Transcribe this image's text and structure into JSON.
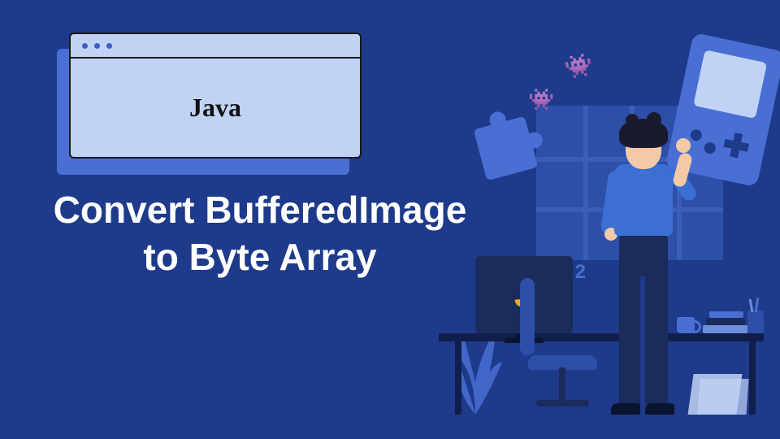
{
  "card": {
    "title": "Java"
  },
  "main_title": "Convert BufferedImage to Byte Array",
  "monitor_logo": {
    "letter": "J",
    "superscript": "2"
  },
  "colors": {
    "background": "#1e3a8a",
    "card_bg": "#c1d3f5",
    "accent": "#4a6fd4",
    "text_light": "#ffffff",
    "text_dark": "#111111",
    "logo_orange": "#f5a623"
  }
}
